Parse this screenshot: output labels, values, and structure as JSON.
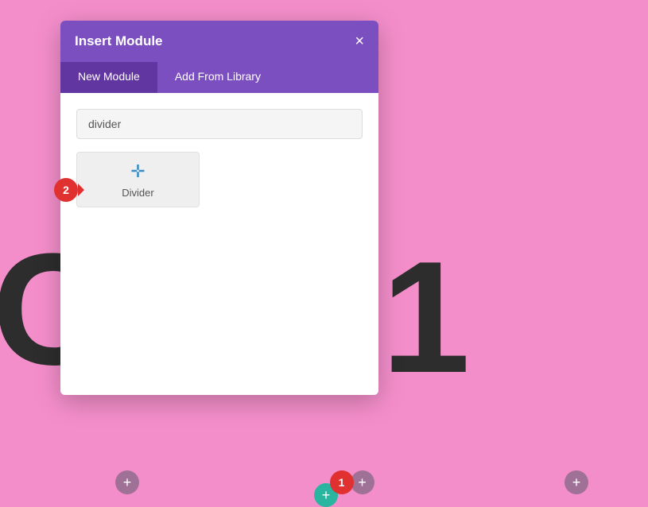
{
  "background": {
    "color": "#f48ecb",
    "letters": [
      "C",
      "1"
    ]
  },
  "modal": {
    "title": "Insert Module",
    "close_label": "×",
    "tabs": [
      {
        "label": "New Module",
        "active": true
      },
      {
        "label": "Add From Library",
        "active": false
      }
    ],
    "search": {
      "placeholder": "",
      "value": "divider"
    },
    "modules": [
      {
        "label": "Divider",
        "icon": "✛"
      }
    ]
  },
  "badges": {
    "badge2_label": "2",
    "badge1_label": "1"
  },
  "bottom_buttons": {
    "plus_label": "+"
  }
}
